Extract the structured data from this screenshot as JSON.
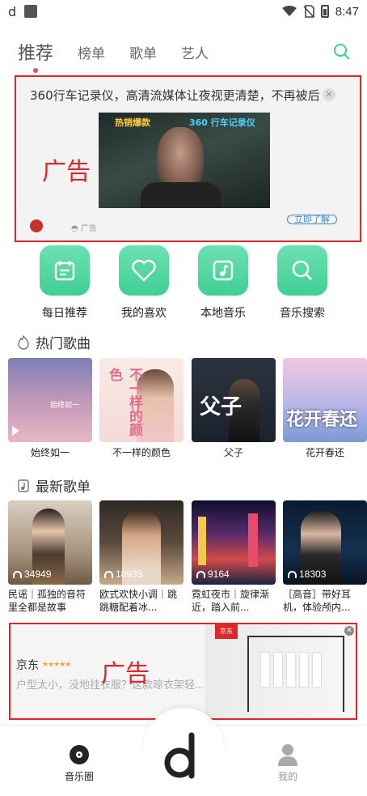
{
  "status_bar": {
    "time": "8:47",
    "app_glyph": "d"
  },
  "tabs": [
    {
      "label": "推荐",
      "active": true
    },
    {
      "label": "榜单",
      "active": false
    },
    {
      "label": "歌单",
      "active": false
    },
    {
      "label": "艺人",
      "active": false
    }
  ],
  "ad_top": {
    "headline": "360行车记录仪，高清流媒体让夜视更清楚，不再被后",
    "overlay_left": "热销爆款",
    "overlay_right": "360 行车记录仪",
    "marker": "广告",
    "source_label": "广告",
    "cta": "立即了解"
  },
  "quick_actions": [
    {
      "label": "每日推荐",
      "icon": "calendar-icon"
    },
    {
      "label": "我的喜欢",
      "icon": "heart-icon"
    },
    {
      "label": "本地音乐",
      "icon": "music-note-icon"
    },
    {
      "label": "音乐搜索",
      "icon": "search-icon"
    }
  ],
  "hot_songs": {
    "title": "热门歌曲",
    "items": [
      {
        "name": "始终如一",
        "cover_text": "始终如一"
      },
      {
        "name": "不一样的颜色",
        "cover_text": "不一样的颜色"
      },
      {
        "name": "父子",
        "cover_text": "父子"
      },
      {
        "name": "花开春还",
        "cover_text": "花开春还"
      }
    ]
  },
  "new_playlists": {
    "title": "最新歌单",
    "items": [
      {
        "count": "34949",
        "name": "民谣｜孤独的音符里全都是故事"
      },
      {
        "count": "18935",
        "name": "欧式欢快小调｜跳跳糖配着冰..."
      },
      {
        "count": "9164",
        "name": "霓虹夜市｜旋律渐近，踏入前..."
      },
      {
        "count": "18303",
        "name": "［高音］带好耳机，体验颅内..."
      }
    ]
  },
  "ad_bottom": {
    "brand": "京东",
    "stars": "★★★★★",
    "desc": "户型太小，没地挂衣服？这款晾衣架轻...",
    "marker": "广告",
    "badge": "京东"
  },
  "bottom_nav": {
    "left_label": "音乐圈",
    "right_label": "我的"
  },
  "colors": {
    "accent": "#3fcf93",
    "ad_border": "#e0262a",
    "tab_dot": "#e8514a"
  }
}
